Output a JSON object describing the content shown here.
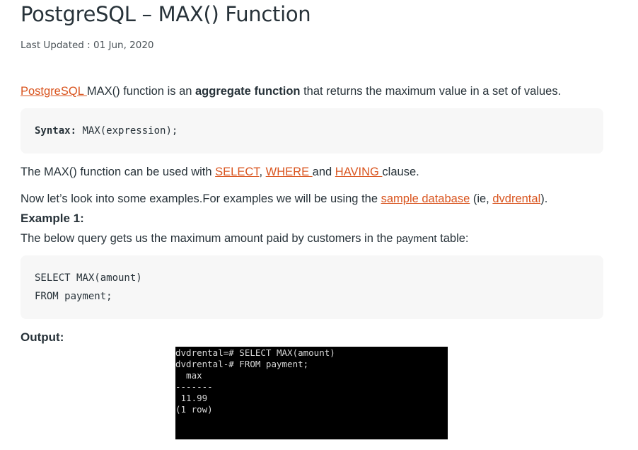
{
  "article": {
    "title": "PostgreSQL – MAX() Function",
    "last_updated": "Last Updated : 01 Jun, 2020",
    "intro": {
      "link": "PostgreSQL ",
      "text1": "MAX() function is an ",
      "bold": "aggregate function",
      "text2": " that returns the maximum value in a set of values."
    },
    "syntax": {
      "label": "Syntax:",
      "code": " MAX(expression);"
    },
    "usage": {
      "text1": "The MAX() function can be used with ",
      "link_select": "SELECT",
      "sep": ", ",
      "link_where": "WHERE ",
      "text2": "and ",
      "link_having": "HAVING ",
      "text3": "clause."
    },
    "examples_intro": {
      "text1": "Now let’s look into some examples.For examples we will be using the ",
      "link_sample": "sample database",
      "text2": " (ie, ",
      "link_dvd": "dvdrental",
      "text3": ")."
    },
    "example1": {
      "heading": "Example 1:",
      "desc1": "The below query gets us the maximum amount paid by customers in the ",
      "desc_code": "payment",
      "desc2": " table:",
      "code_lines": [
        "SELECT MAX(amount)",
        "FROM payment;"
      ]
    },
    "output_heading": "Output:",
    "terminal_lines": [
      "dvdrental=# SELECT MAX(amount)",
      "dvdrental-# FROM payment;",
      "  max",
      "-------",
      " 11.99",
      "(1 row)"
    ]
  }
}
